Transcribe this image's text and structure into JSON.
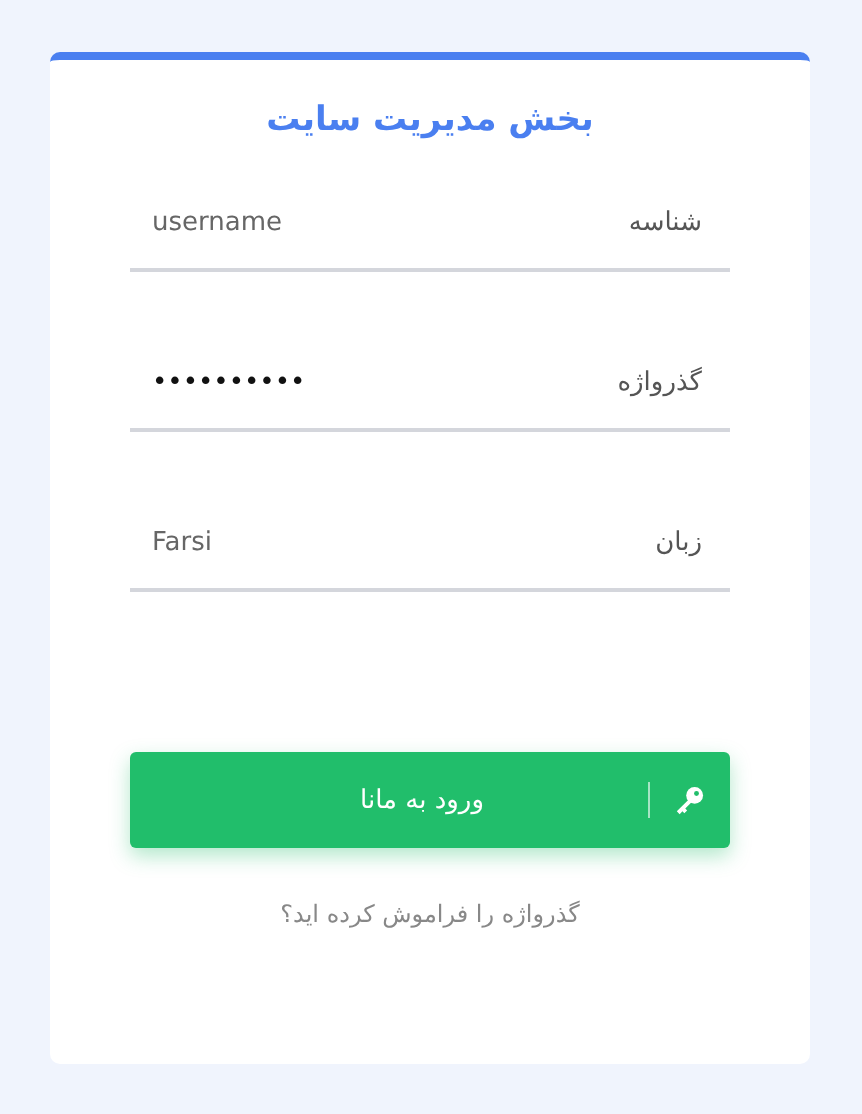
{
  "title": "بخش مدیریت سایت",
  "fields": [
    {
      "label": "شناسه",
      "value": "username",
      "kind": "text"
    },
    {
      "label": "گذرواژه",
      "value": "••••••••••",
      "kind": "password"
    },
    {
      "label": "زبان",
      "value": "Farsi",
      "kind": "text"
    }
  ],
  "login_button": "ورود به مانا",
  "forgot_link": "گذرواژه را فراموش کرده اید؟"
}
